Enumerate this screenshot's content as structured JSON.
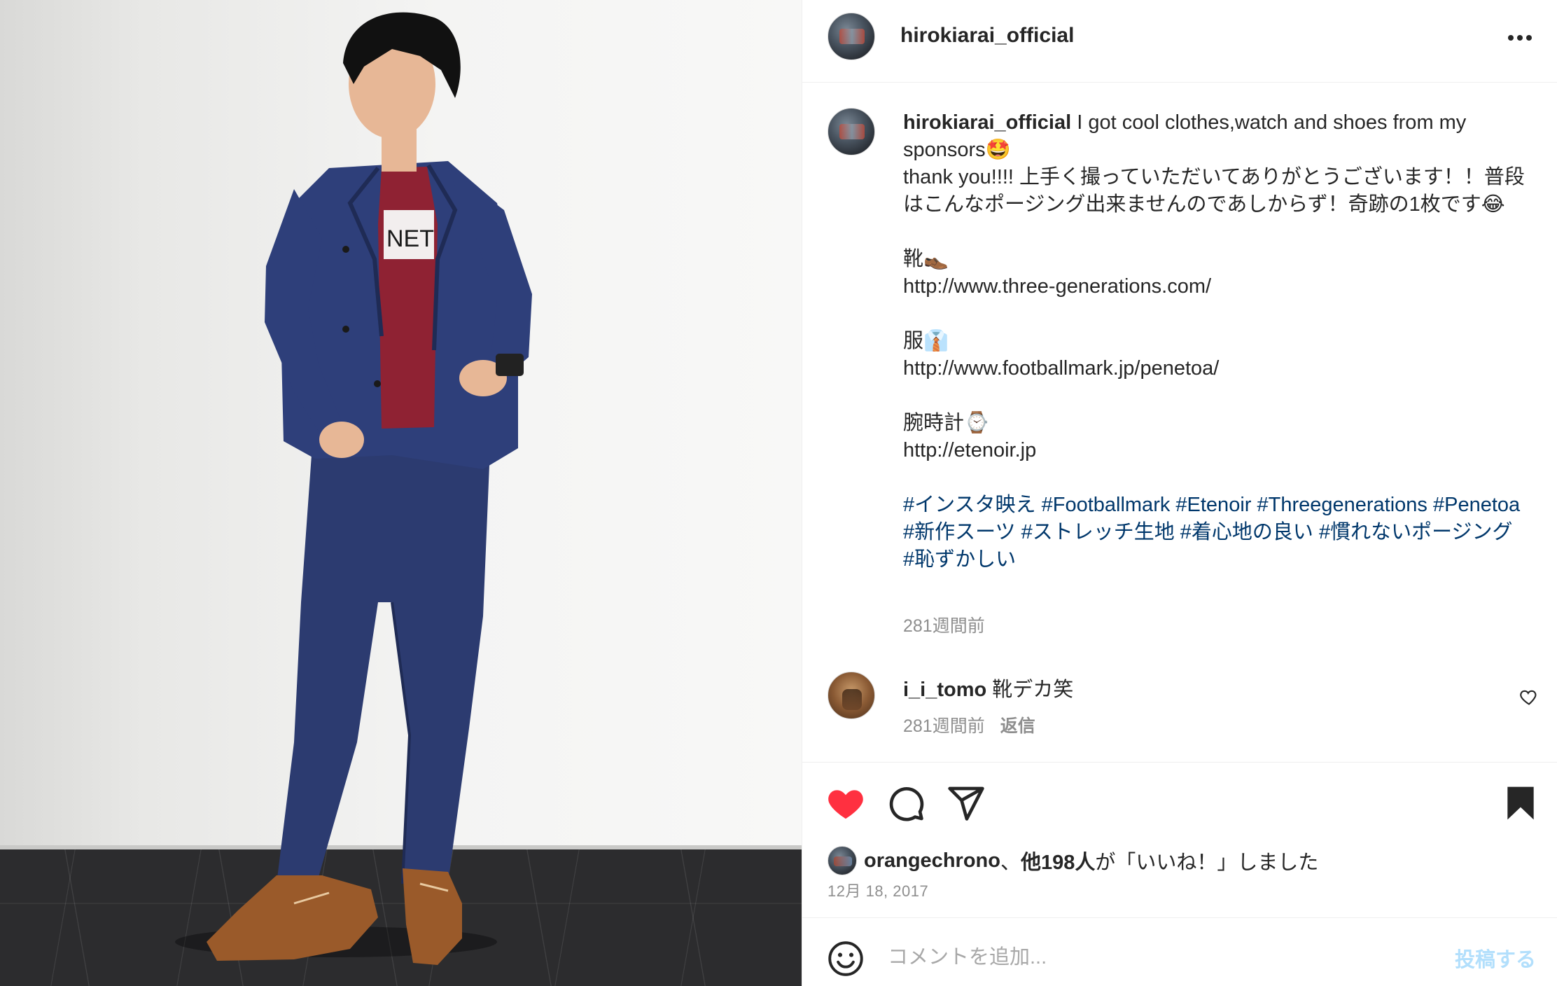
{
  "post": {
    "author": "hirokiarai_official",
    "photo_alt": "Man in navy suit, red t-shirt and brown shoes leaning against a white wall"
  },
  "caption": {
    "username": "hirokiarai_official",
    "text": " I got cool clothes,watch and shoes from my sponsors🤩\nthank you!!!! 上手く撮っていただいてありがとうございます！！普段はこんなポージング出来ませんのであしからず！奇跡の1枚です😂\n\n靴👞\n",
    "link1": "http://www.three-generations.com/",
    "section2": "\n\n服👔\n",
    "link2": "http://www.footballmark.jp/penetoa/",
    "section3": "\n\n腕時計⌚\n",
    "link3": "http://etenoir.jp",
    "spacer": "\n\n",
    "hashtags": "#インスタ映え #Footballmark #Etenoir #Threegenerations #Penetoa #新作スーツ #ストレッチ生地 #着心地の良い #慣れないポージング #恥ずかしい",
    "time_ago": "281週間前"
  },
  "comment": {
    "username": "i_i_tomo",
    "text": " 靴デカ笑",
    "time_ago": "281週間前",
    "reply_label": "返信",
    "like_icon": "heart-outline-icon"
  },
  "actions": {
    "like_icon": "heart-filled-icon",
    "like_color": "#ff3040",
    "comment_icon": "speech-bubble-icon",
    "share_icon": "paper-plane-icon",
    "save_icon": "bookmark-filled-icon"
  },
  "likes": {
    "first_user": "orangechrono",
    "sep": "、",
    "others": "他198人",
    "suffix": "が「いいね！」しました"
  },
  "date": "12月 18, 2017",
  "add_comment": {
    "placeholder": "コメントを追加...",
    "post_label": "投稿する",
    "emoji_icon": "smiley-icon"
  }
}
